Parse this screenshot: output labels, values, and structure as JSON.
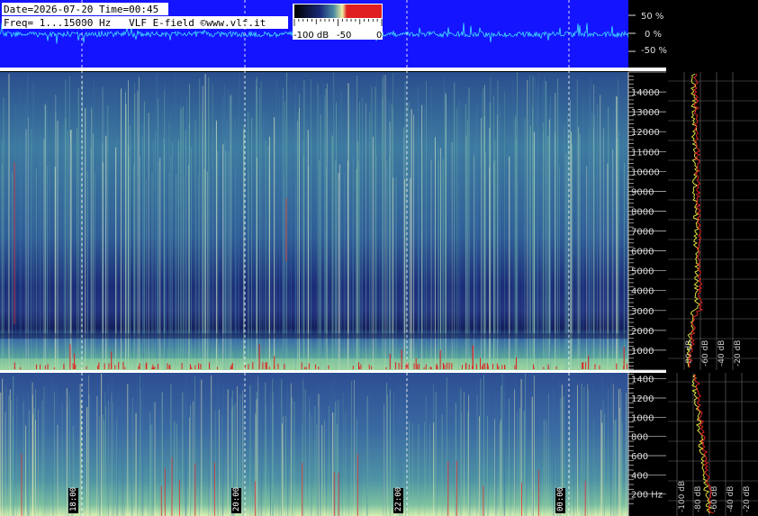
{
  "header": {
    "date_line": "Date=2026-07-20 Time=00:45",
    "freq_line": "Freq= 1...15000 Hz   VLF E-field ©www.vlf.it"
  },
  "colorbar": {
    "ticks": [
      "-100 dB",
      "-50",
      "0"
    ],
    "colors": [
      "#000000",
      "#1a2a7a",
      "#4a8aa0",
      "#f0f0a0",
      "#e02020"
    ]
  },
  "waveform": {
    "ticks": [
      "50 %",
      "0 %",
      "-50 %"
    ],
    "background": "#1414ff",
    "trace_color": "#40e0ff"
  },
  "chart_data": [
    {
      "type": "heatmap",
      "name": "spectrogram-upper",
      "ylim": [
        0,
        15000
      ],
      "yticks": [
        "14000",
        "13000",
        "12000",
        "11000",
        "10000",
        "9000",
        "8000",
        "7000",
        "6000",
        "5000",
        "4000",
        "3000",
        "2000",
        "1000"
      ],
      "ytick_values": [
        14000,
        13000,
        12000,
        11000,
        10000,
        9000,
        8000,
        7000,
        6000,
        5000,
        4000,
        3000,
        2000,
        1000
      ],
      "time_markers": [
        "18:00",
        "20:00",
        "22:00",
        "00:00"
      ]
    },
    {
      "type": "heatmap",
      "name": "spectrogram-lower",
      "ylim": [
        0,
        1500
      ],
      "yticks": [
        "1400",
        "1200",
        "1000",
        "800",
        "600",
        "400",
        "200 Hz"
      ],
      "ytick_values": [
        1400,
        1200,
        1000,
        800,
        600,
        400,
        200
      ]
    },
    {
      "type": "line",
      "name": "spectrum-upper",
      "xticks": [
        "-80 dB",
        "-60 dB",
        "-40 dB",
        "-20 dB"
      ],
      "xtick_values": [
        -80,
        -60,
        -40,
        -20
      ]
    },
    {
      "type": "line",
      "name": "spectrum-lower",
      "xticks": [
        "-100 dB",
        "-80 dB",
        "-60 dB",
        "-40 dB",
        "-20 dB"
      ],
      "xtick_values": [
        -100,
        -80,
        -60,
        -40,
        -20
      ]
    }
  ]
}
